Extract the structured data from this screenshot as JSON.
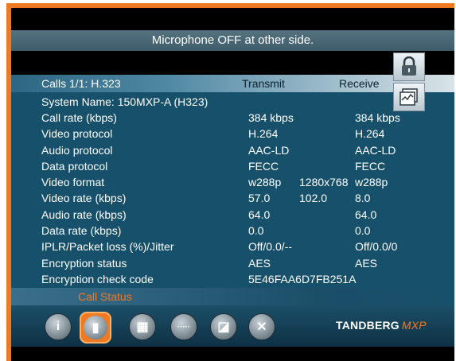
{
  "banner": {
    "message": "Microphone OFF at other side."
  },
  "table": {
    "calls_label": "Calls 1/1: H.323",
    "transmit_header": "Transmit",
    "receive_header": "Receive",
    "system_name": "System Name: 150MXP-A (H323)",
    "rows": [
      {
        "label": "Call rate (kbps)",
        "tx": "384 kbps",
        "tx2": "",
        "rx": "384 kbps"
      },
      {
        "label": "Video protocol",
        "tx": "H.264",
        "tx2": "",
        "rx": "H.264"
      },
      {
        "label": "Audio protocol",
        "tx": "AAC-LD",
        "tx2": "",
        "rx": "AAC-LD"
      },
      {
        "label": "Data protocol",
        "tx": "FECC",
        "tx2": "",
        "rx": "FECC"
      },
      {
        "label": "Video format",
        "tx": "w288p",
        "tx2": "1280x768",
        "rx": "w288p"
      },
      {
        "label": "Video rate (kbps)",
        "tx": "57.0",
        "tx2": "102.0",
        "rx": "8.0"
      },
      {
        "label": "Audio rate (kbps)",
        "tx": "64.0",
        "tx2": "",
        "rx": "64.0"
      },
      {
        "label": "Data rate (kbps)",
        "tx": "0.0",
        "tx2": "",
        "rx": "0.0"
      },
      {
        "label": "IPLR/Packet loss (%)/Jitter",
        "tx": "Off/0.0/--",
        "tx2": "",
        "rx": "Off/0.0/0"
      },
      {
        "label": "Encryption status",
        "tx": "AES",
        "tx2": "",
        "rx": "AES"
      },
      {
        "label": "Encryption check code",
        "tx": "5E46FAA6D7FB251A",
        "tx2": "",
        "rx": ""
      }
    ]
  },
  "status": {
    "label": "Call Status"
  },
  "toolbar": {
    "buttons": [
      {
        "name": "info-icon",
        "glyph": "i"
      },
      {
        "name": "call-status-icon",
        "glyph": "▮"
      },
      {
        "name": "film-icon",
        "glyph": "▦"
      },
      {
        "name": "dots-icon",
        "glyph": "·····"
      },
      {
        "name": "picture-icon",
        "glyph": "◪"
      },
      {
        "name": "close-icon",
        "glyph": "✕"
      }
    ],
    "selected_index": 1
  },
  "side_icons": [
    {
      "name": "lock-icon"
    },
    {
      "name": "graph-icon"
    }
  ],
  "brand": {
    "name": "TANDBERG",
    "model": "MXP"
  },
  "colors": {
    "accent": "#f07a21",
    "panel": "#17506b"
  }
}
